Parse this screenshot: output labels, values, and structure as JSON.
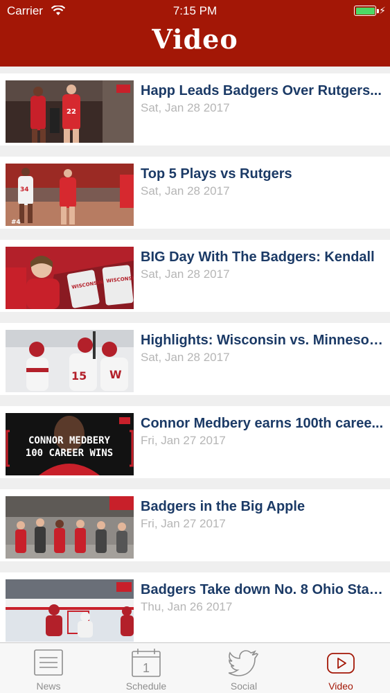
{
  "status_bar": {
    "carrier": "Carrier",
    "time": "7:15 PM",
    "battery_color": "#4cd964"
  },
  "header": {
    "title": "Video",
    "background_color": "#a31706"
  },
  "videos": [
    {
      "title": "Happ Leads Badgers Over Rutgers...",
      "date": "Sat, Jan 28 2017",
      "thumbnail": "basketball-players-court"
    },
    {
      "title": "Top 5 Plays vs Rutgers",
      "date": "Sat, Jan 28 2017",
      "thumbnail": "basketball-game-action"
    },
    {
      "title": "BIG Day With The Badgers: Kendall",
      "date": "Sat, Jan 28 2017",
      "thumbnail": "child-in-stands"
    },
    {
      "title": "Highlights: Wisconsin vs. Minnesot...",
      "date": "Sat, Jan 28 2017",
      "thumbnail": "hockey-celebration"
    },
    {
      "title": "Connor Medbery earns 100th caree...",
      "date": "Fri, Jan 27 2017",
      "thumbnail": "wrestling-graphic",
      "thumbnail_text": [
        "CONNOR MEDBERY",
        "100 CAREER WINS"
      ]
    },
    {
      "title": "Badgers in the Big Apple",
      "date": "Fri, Jan 27 2017",
      "thumbnail": "team-in-city"
    },
    {
      "title": "Badgers Take down No. 8 Ohio Stat...",
      "date": "Thu, Jan 26 2017",
      "thumbnail": "hockey-rink"
    }
  ],
  "tabs": [
    {
      "label": "News",
      "icon": "newspaper-icon",
      "active": false
    },
    {
      "label": "Schedule",
      "icon": "calendar-icon",
      "active": false,
      "icon_text": "1"
    },
    {
      "label": "Social",
      "icon": "twitter-bird-icon",
      "active": false
    },
    {
      "label": "Video",
      "icon": "play-video-icon",
      "active": true
    }
  ]
}
